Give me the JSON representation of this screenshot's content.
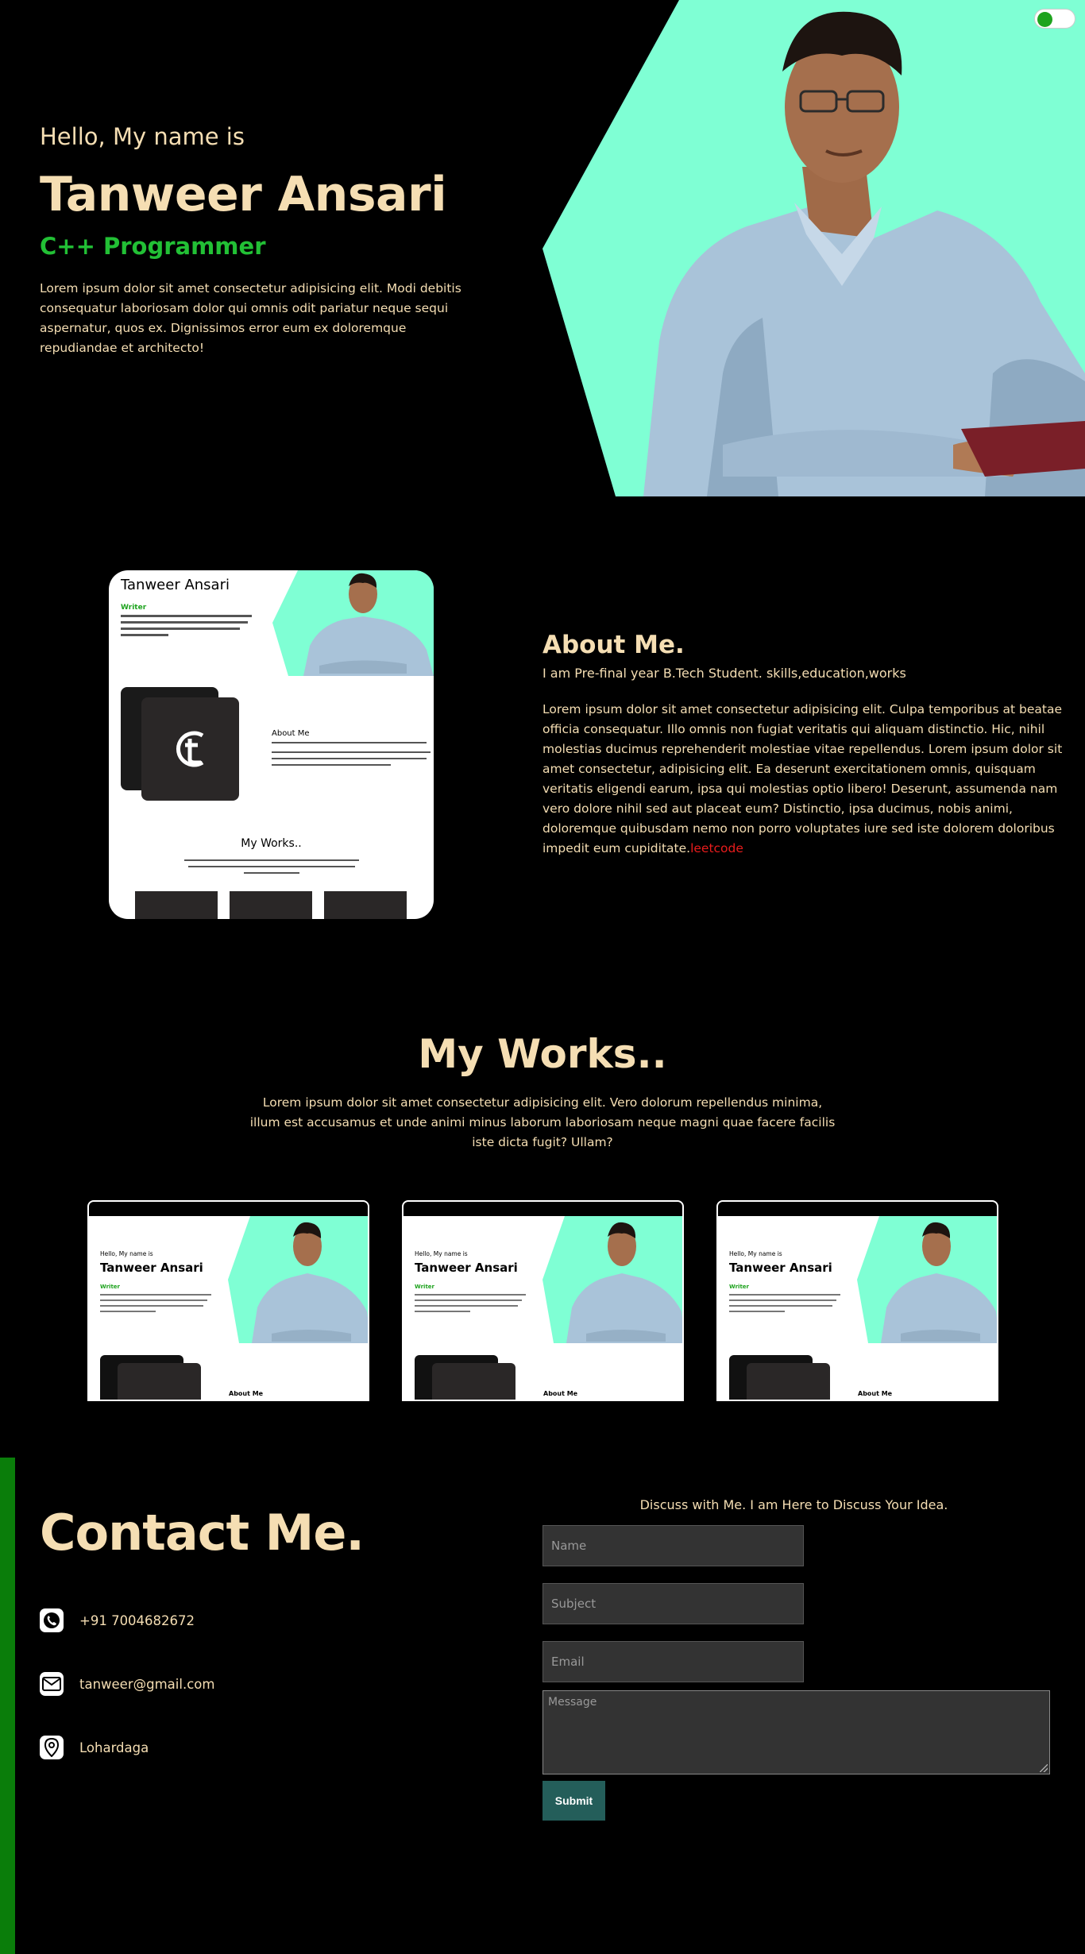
{
  "hero": {
    "greeting": "Hello, My name is",
    "name": "Tanweer Ansari",
    "role": "C++ Programmer",
    "description": "Lorem ipsum dolor sit amet consectetur adipisicing elit. Modi debitis consequatur laboriosam dolor qui omnis odit pariatur neque sequi aspernatur, quos ex. Dignissimos error eum ex doloremque repudiandae et architecto!",
    "photo_icon": "portrait-photo",
    "theme_toggle_on": true
  },
  "about": {
    "preview": {
      "name": "Tanweer Ansari",
      "role": "Writer",
      "about_label": "About Me",
      "works_label": "My Works.."
    },
    "title": "About Me.",
    "subtitle": "I am Pre-final year B.Tech Student. skills,education,works",
    "description": "Lorem ipsum dolor sit amet consectetur adipisicing elit. Culpa temporibus at beatae officia consequatur. Illo omnis non fugiat veritatis qui aliquam distinctio. Hic, nihil molestias ducimus reprehenderit molestiae vitae repellendus. Lorem ipsum dolor sit amet consectetur, adipisicing elit. Ea deserunt exercitationem omnis, quisquam veritatis eligendi earum, ipsa qui molestias optio libero! Deserunt, assumenda nam vero dolore nihil sed aut placeat eum? Distinctio, ipsa ducimus, nobis animi, doloremque quibusdam nemo non porro voluptates iure sed iste dolorem doloribus impedit eum cupiditate.",
    "link_text": "leetcode"
  },
  "works": {
    "title": "My Works..",
    "description": "Lorem ipsum dolor sit amet consectetur adipisicing elit. Vero dolorum repellendus minima, illum est accusamus et unde animi minus laborum laboriosam neque magni quae facere facilis iste dicta fugit? Ullam?",
    "cards": [
      {
        "hello": "Hello, My name is",
        "name": "Tanweer Ansari",
        "role": "Writer",
        "about": "About Me"
      },
      {
        "hello": "Hello, My name is",
        "name": "Tanweer Ansari",
        "role": "Writer",
        "about": "About Me"
      },
      {
        "hello": "Hello, My name is",
        "name": "Tanweer Ansari",
        "role": "Writer",
        "about": "About Me"
      }
    ]
  },
  "contact": {
    "title": "Contact Me.",
    "phone": "+91 7004682672",
    "email": "tanweer@gmail.com",
    "location": "Lohardaga",
    "icons": [
      "phone-icon",
      "mail-icon",
      "location-pin-icon"
    ],
    "form_heading": "Discuss with Me. I am Here to Discuss Your Idea.",
    "name_placeholder": "Name",
    "subject_placeholder": "Subject",
    "email_placeholder": "Email",
    "message_placeholder": "Message",
    "submit_label": "Submit"
  },
  "colors": {
    "background": "#000000",
    "text": "#f5deb3",
    "accent_green": "#22c035",
    "aquamarine": "#7fffd4",
    "link_red": "#e81c1c",
    "submit_bg": "#245e5a"
  }
}
